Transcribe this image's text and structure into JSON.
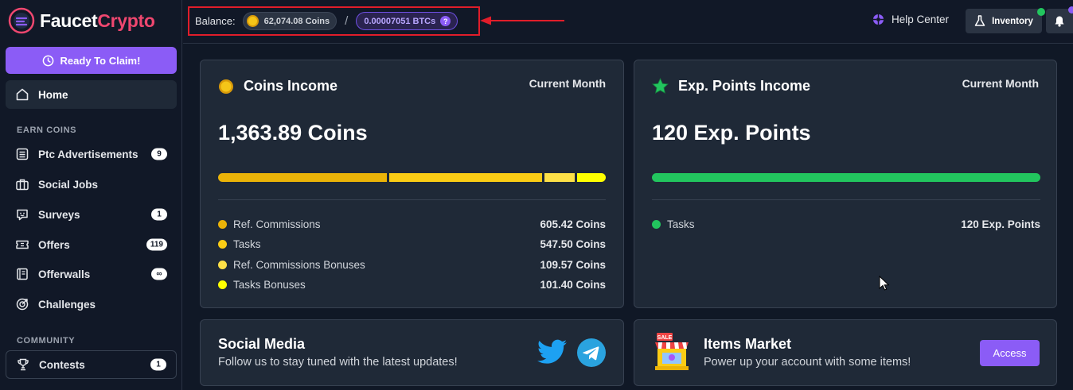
{
  "brand": {
    "name_part1": "Faucet",
    "name_part2": "Crypto"
  },
  "sidebar": {
    "claim_button": "Ready To Claim!",
    "home": "Home",
    "section_earn": "EARN COINS",
    "items": [
      {
        "label": "Ptc Advertisements",
        "badge": "9",
        "icon": "list-icon"
      },
      {
        "label": "Social Jobs",
        "badge": "",
        "icon": "briefcase-icon"
      },
      {
        "label": "Surveys",
        "badge": "1",
        "icon": "survey-icon"
      },
      {
        "label": "Offers",
        "badge": "119",
        "icon": "ticket-icon"
      },
      {
        "label": "Offerwalls",
        "badge": "∞",
        "icon": "book-icon"
      },
      {
        "label": "Challenges",
        "badge": "",
        "icon": "target-icon"
      }
    ],
    "section_community": "COMMUNITY",
    "community_items": [
      {
        "label": "Contests",
        "badge": "1",
        "icon": "trophy-icon"
      }
    ]
  },
  "topbar": {
    "balance_label": "Balance:",
    "coins": "62,074.08 Coins",
    "separator": "/",
    "btc": "0.00007051 BTCs",
    "btc_help": "?",
    "help_center": "Help Center",
    "inventory": "Inventory"
  },
  "coins_income": {
    "title": "Coins Income",
    "period": "Current Month",
    "total": "1,363.89 Coins",
    "rows": [
      {
        "label": "Ref. Commissions",
        "value": "605.42 Coins",
        "color": "#eab308",
        "amount": 605.42
      },
      {
        "label": "Tasks",
        "value": "547.50 Coins",
        "color": "#facc15",
        "amount": 547.5
      },
      {
        "label": "Ref. Commissions Bonuses",
        "value": "109.57 Coins",
        "color": "#fde047",
        "amount": 109.57
      },
      {
        "label": "Tasks Bonuses",
        "value": "101.40 Coins",
        "color": "#ffff00",
        "amount": 101.4
      }
    ]
  },
  "exp_income": {
    "title": "Exp. Points Income",
    "period": "Current Month",
    "total": "120 Exp. Points",
    "bar_color": "#22c55e",
    "rows": [
      {
        "label": "Tasks",
        "value": "120 Exp. Points",
        "color": "#22c55e"
      }
    ]
  },
  "social": {
    "title": "Social Media",
    "subtitle": "Follow us to stay tuned with the latest updates!"
  },
  "market": {
    "title": "Items Market",
    "subtitle": "Power up your account with some items!",
    "button": "Access",
    "sign": "SALE"
  }
}
